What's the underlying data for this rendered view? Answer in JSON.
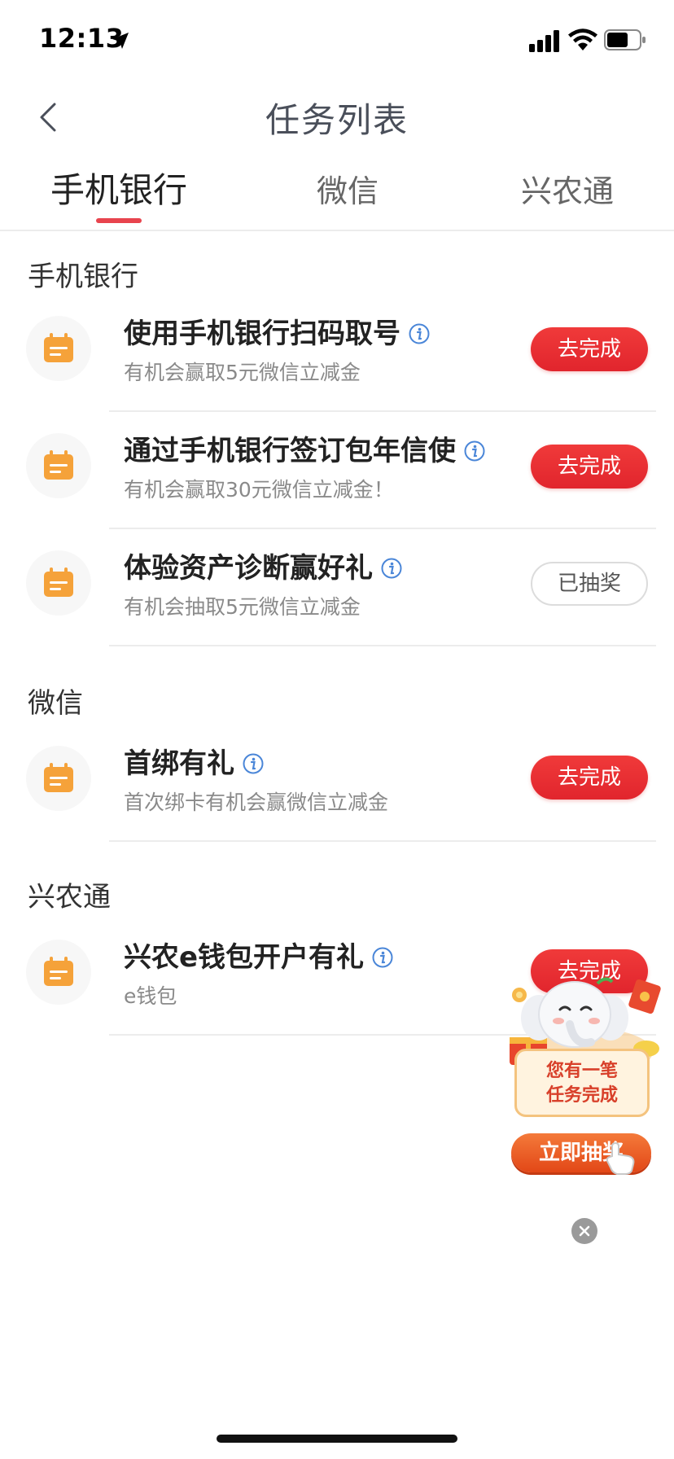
{
  "status_bar": {
    "time": "12:13"
  },
  "header": {
    "title": "任务列表"
  },
  "tabs": [
    {
      "label": "手机银行",
      "active": true
    },
    {
      "label": "微信",
      "active": false
    },
    {
      "label": "兴农通",
      "active": false
    }
  ],
  "sections": [
    {
      "title": "手机银行",
      "tasks": [
        {
          "title": "使用手机银行扫码取号",
          "subtitle": "有机会赢取5元微信立减金",
          "button": "去完成",
          "state": "todo"
        },
        {
          "title": "通过手机银行签订包年信使",
          "subtitle": "有机会赢取30元微信立减金！",
          "button": "去完成",
          "state": "todo"
        },
        {
          "title": "体验资产诊断赢好礼",
          "subtitle": "有机会抽取5元微信立减金",
          "button": "已抽奖",
          "state": "done"
        }
      ]
    },
    {
      "title": "微信",
      "tasks": [
        {
          "title": "首绑有礼",
          "subtitle": "首次绑卡有机会赢微信立减金",
          "button": "去完成",
          "state": "todo"
        }
      ]
    },
    {
      "title": "兴农通",
      "tasks": [
        {
          "title": "兴农e钱包开户有礼",
          "subtitle": "e钱包",
          "button": "去完成",
          "state": "todo"
        }
      ]
    }
  ],
  "promo": {
    "line1": "您有一笔",
    "line2": "任务完成",
    "button": "立即抽奖"
  },
  "colors": {
    "accent_red": "#e8444e",
    "icon_orange": "#f5a23a",
    "info_blue": "#4a86d8"
  }
}
